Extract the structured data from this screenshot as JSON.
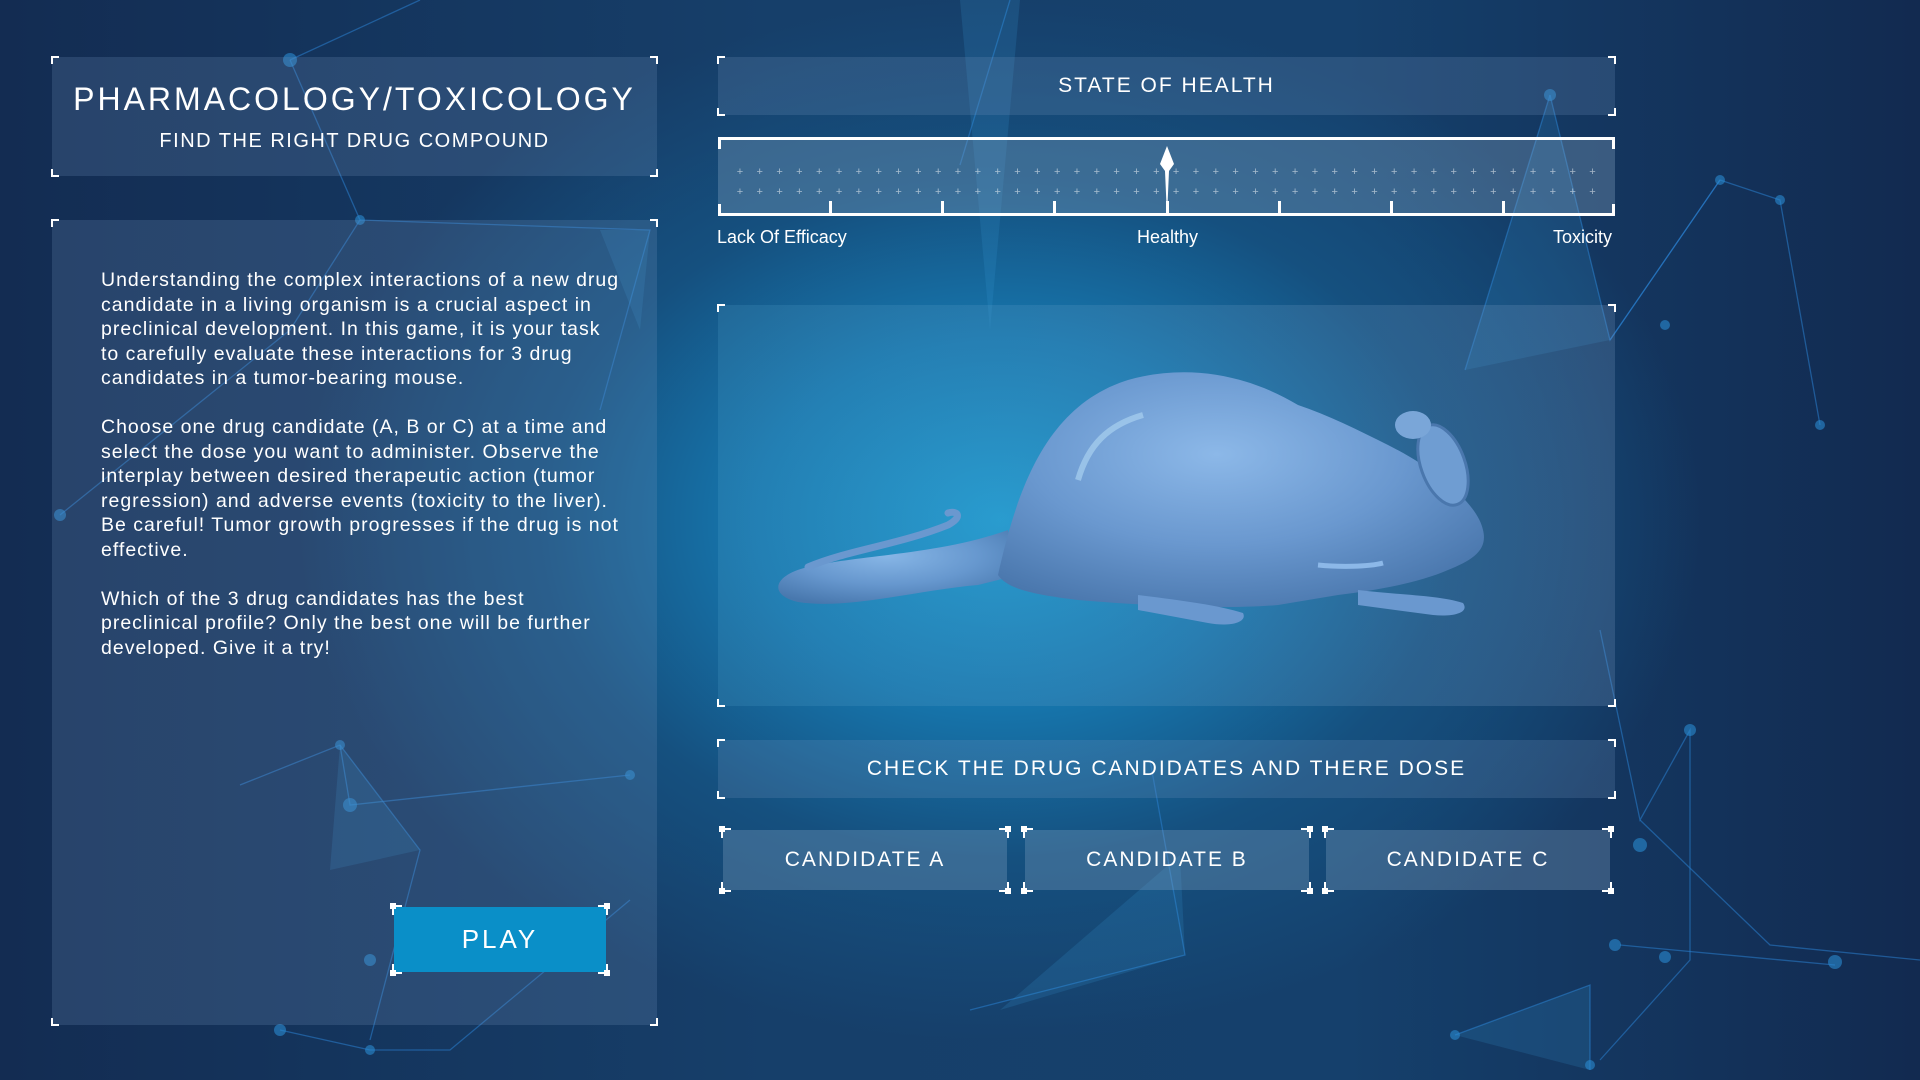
{
  "header": {
    "title": "PHARMACOLOGY/TOXICOLOGY",
    "subtitle": "FIND THE RIGHT DRUG COMPOUND"
  },
  "description": {
    "paragraphs": [
      "Understanding the complex interactions of a new drug candidate in a living organism is a crucial aspect in preclinical development. In this game, it is your task to carefully evaluate these interactions for 3 drug candidates in a tumor-bearing mouse.",
      "Choose one drug candidate (A, B or C) at a time and select the dose you want to administer. Observe the interplay between desired therapeutic action (tumor regression) and adverse events (toxicity to the liver). Be careful! Tumor growth progresses if the drug is not effective.",
      "Which of the 3 drug candidates has the best preclinical profile? Only the best one will be further developed. Give it a try!"
    ],
    "play_label": "PLAY"
  },
  "health": {
    "title": "STATE OF HEALTH",
    "labels": {
      "left": "Lack Of Efficacy",
      "center": "Healthy",
      "right": "Toxicity"
    },
    "needle_value": 0.5,
    "tick_count": 7
  },
  "mouse_panel": {
    "image": "mouse-model"
  },
  "candidates": {
    "title": "CHECK THE DRUG CANDIDATES AND THERE DOSE",
    "buttons": [
      {
        "label": "CANDIDATE A"
      },
      {
        "label": "CANDIDATE B"
      },
      {
        "label": "CANDIDATE C"
      }
    ]
  },
  "colors": {
    "accent": "#0a8fc8",
    "background_dark": "#132c52",
    "background_glow": "#1a9ad0"
  }
}
